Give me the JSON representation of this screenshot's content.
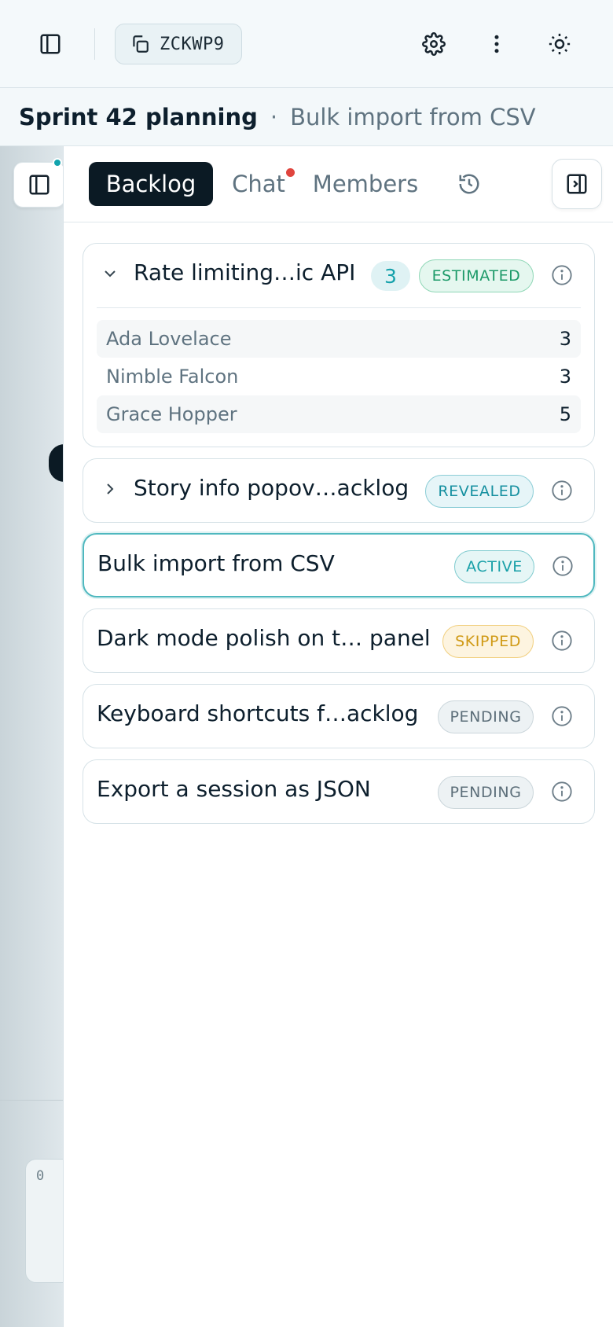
{
  "topbar": {
    "room_code": "ZCKWP9"
  },
  "title": {
    "session": "Sprint 42 planning",
    "separator": "·",
    "current_story": "Bulk import from CSV"
  },
  "background": {
    "card_value": "0"
  },
  "tabs": [
    {
      "label": "Backlog",
      "active": true
    },
    {
      "label": "Chat",
      "unread": true
    },
    {
      "label": "Members"
    }
  ],
  "stories": [
    {
      "title": "Rate limiting…ic API",
      "score": "3",
      "status": "ESTIMATED",
      "expanded": true,
      "votes": [
        {
          "name": "Ada Lovelace",
          "value": "3"
        },
        {
          "name": "Nimble Falcon",
          "value": "3"
        },
        {
          "name": "Grace Hopper",
          "value": "5"
        }
      ]
    },
    {
      "title": "Story info popov…acklog",
      "status": "REVEALED",
      "expanded": false
    },
    {
      "title": "Bulk import from CSV",
      "status": "ACTIVE",
      "current": true
    },
    {
      "title": "Dark mode polish on t… panel",
      "status": "SKIPPED"
    },
    {
      "title": "Keyboard shortcuts f…acklog",
      "status": "PENDING"
    },
    {
      "title": "Export a session as JSON",
      "status": "PENDING"
    }
  ],
  "colors": {
    "accent": "#12a3ad",
    "active_tab": "#0b1a24",
    "unread_dot": "#e0453e",
    "estimated": "#1d9a69",
    "skipped": "#d09a16"
  }
}
